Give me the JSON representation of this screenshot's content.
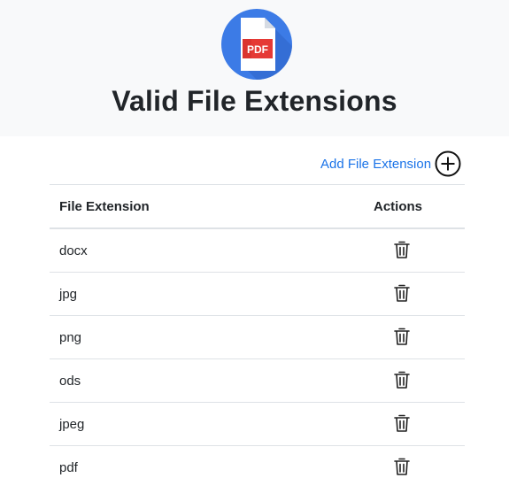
{
  "header": {
    "logo_text": "PDF",
    "title": "Valid File Extensions"
  },
  "toolbar": {
    "add_label": "Add File Extension"
  },
  "table": {
    "columns": [
      "File Extension",
      "Actions"
    ],
    "rows": [
      {
        "extension": "docx"
      },
      {
        "extension": "jpg"
      },
      {
        "extension": "png"
      },
      {
        "extension": "ods"
      },
      {
        "extension": "jpeg"
      },
      {
        "extension": "pdf"
      }
    ]
  },
  "colors": {
    "logo_blue": "#3c7be6",
    "pdf_red": "#e53935",
    "link_blue": "#1a73e8",
    "header_bg": "#f8f9fa"
  },
  "icons": {
    "add": "plus-circle-icon",
    "delete": "trash-icon",
    "logo": "pdf-file-icon"
  }
}
